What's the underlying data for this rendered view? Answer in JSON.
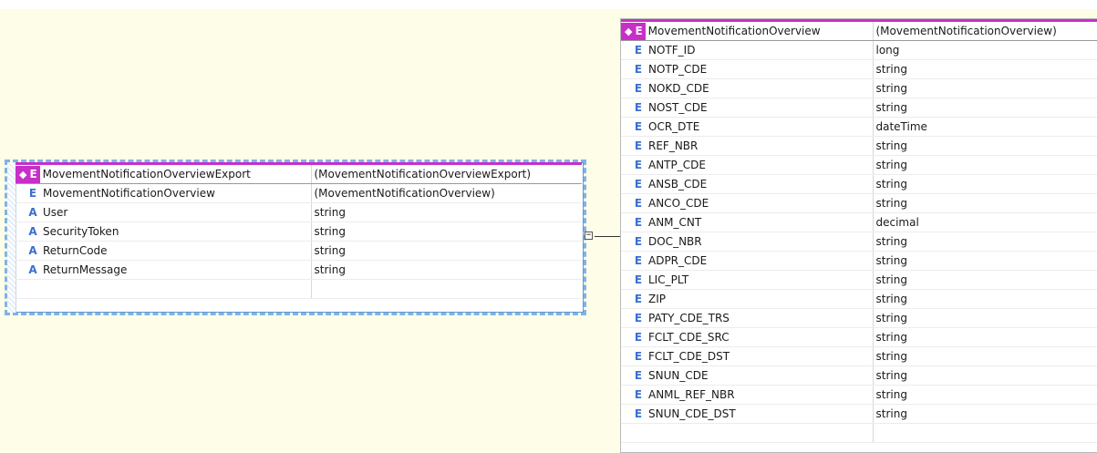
{
  "left_entity": {
    "header": {
      "icon": "◆",
      "kind": "E",
      "name": "MovementNotificationOverviewExport",
      "type": "(MovementNotificationOverviewExport)"
    },
    "rows": [
      {
        "kind": "E",
        "name": "MovementNotificationOverview",
        "type": "(MovementNotificationOverview)"
      },
      {
        "kind": "A",
        "name": "User",
        "type": "string"
      },
      {
        "kind": "A",
        "name": "SecurityToken",
        "type": "string"
      },
      {
        "kind": "A",
        "name": "ReturnCode",
        "type": "string"
      },
      {
        "kind": "A",
        "name": "ReturnMessage",
        "type": "string"
      },
      {
        "kind": "",
        "name": "",
        "type": ""
      }
    ]
  },
  "connector": {
    "collapse_symbol": "−"
  },
  "right_entity": {
    "header": {
      "icon": "◆",
      "kind": "E",
      "name": "MovementNotificationOverview",
      "type": "(MovementNotificationOverview)"
    },
    "rows": [
      {
        "kind": "E",
        "name": "NOTF_ID",
        "type": "long"
      },
      {
        "kind": "E",
        "name": "NOTP_CDE",
        "type": "string"
      },
      {
        "kind": "E",
        "name": "NOKD_CDE",
        "type": "string"
      },
      {
        "kind": "E",
        "name": "NOST_CDE",
        "type": "string"
      },
      {
        "kind": "E",
        "name": "OCR_DTE",
        "type": "dateTime"
      },
      {
        "kind": "E",
        "name": "REF_NBR",
        "type": "string"
      },
      {
        "kind": "E",
        "name": "ANTP_CDE",
        "type": "string"
      },
      {
        "kind": "E",
        "name": "ANSB_CDE",
        "type": "string"
      },
      {
        "kind": "E",
        "name": "ANCO_CDE",
        "type": "string"
      },
      {
        "kind": "E",
        "name": "ANM_CNT",
        "type": "decimal"
      },
      {
        "kind": "E",
        "name": "DOC_NBR",
        "type": "string"
      },
      {
        "kind": "E",
        "name": "ADPR_CDE",
        "type": "string"
      },
      {
        "kind": "E",
        "name": "LIC_PLT",
        "type": "string"
      },
      {
        "kind": "E",
        "name": "ZIP",
        "type": "string"
      },
      {
        "kind": "E",
        "name": "PATY_CDE_TRS",
        "type": "string"
      },
      {
        "kind": "E",
        "name": "FCLT_CDE_SRC",
        "type": "string"
      },
      {
        "kind": "E",
        "name": "FCLT_CDE_DST",
        "type": "string"
      },
      {
        "kind": "E",
        "name": "SNUN_CDE",
        "type": "string"
      },
      {
        "kind": "E",
        "name": "ANML_REF_NBR",
        "type": "string"
      },
      {
        "kind": "E",
        "name": "SNUN_CDE_DST",
        "type": "string"
      },
      {
        "kind": "",
        "name": "",
        "type": ""
      }
    ]
  },
  "colors": {
    "header_accent": "#c82fc8",
    "kind_letter": "#3a6fd1",
    "surface": "#fdfde8",
    "selection": "#7fb3e8"
  }
}
